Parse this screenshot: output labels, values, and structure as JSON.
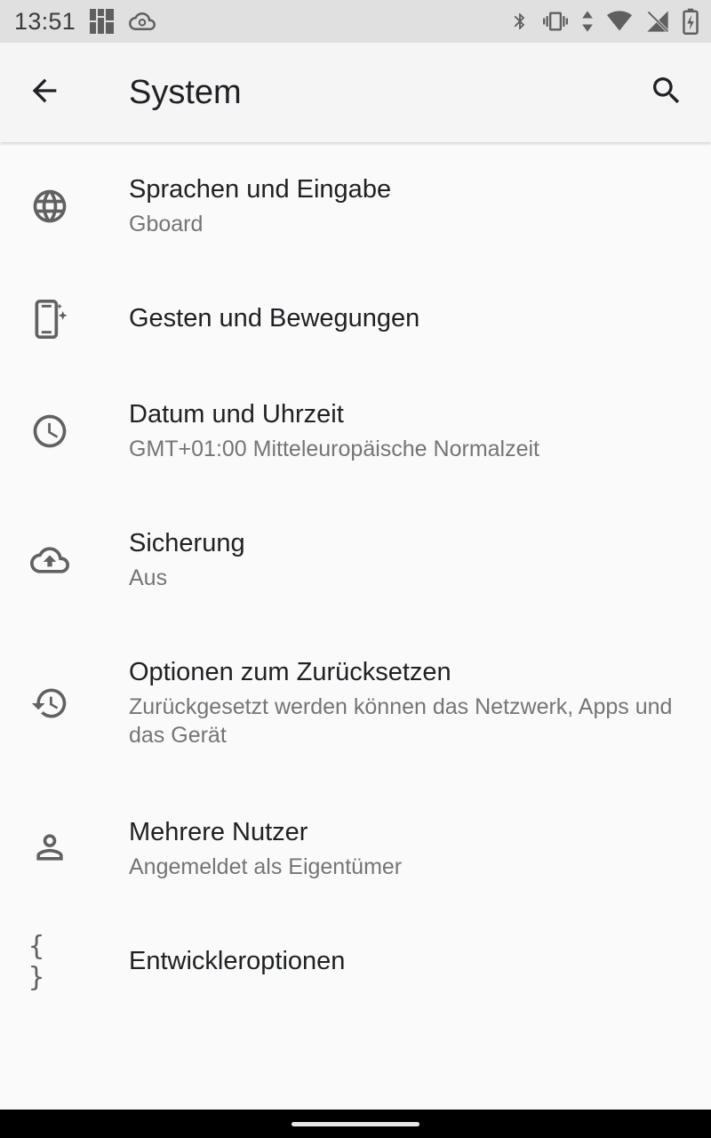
{
  "status_bar": {
    "time": "13:51",
    "left_icons": [
      "grid-app-icon",
      "cloud-sync-icon"
    ],
    "right_icons": [
      "bluetooth-icon",
      "vibrate-icon",
      "data-arrows-icon",
      "wifi-icon",
      "no-sim-icon",
      "battery-charging-icon"
    ]
  },
  "app_bar": {
    "title": "System",
    "back_icon": "arrow-back-icon",
    "search_icon": "search-icon"
  },
  "settings": [
    {
      "title": "Sprachen und Eingabe",
      "summary": "Gboard",
      "icon": "globe-icon"
    },
    {
      "title": "Gesten und Bewegungen",
      "summary": "",
      "icon": "gesture-phone-icon"
    },
    {
      "title": "Datum und Uhrzeit",
      "summary": "GMT+01:00 Mitteleuropäische Normalzeit",
      "icon": "clock-icon"
    },
    {
      "title": "Sicherung",
      "summary": "Aus",
      "icon": "cloud-upload-icon"
    },
    {
      "title": "Optionen zum Zurücksetzen",
      "summary": "Zurückgesetzt werden können das Netzwerk, Apps und das Gerät",
      "icon": "history-icon"
    },
    {
      "title": "Mehrere Nutzer",
      "summary": "Angemeldet als Eigentümer",
      "icon": "person-icon"
    },
    {
      "title": "Entwickleroptionen",
      "summary": "",
      "icon": "braces-icon"
    }
  ],
  "colors": {
    "status_bar_bg": "#e0e0e0",
    "app_bar_bg": "#f5f5f5",
    "background": "#fafafa",
    "title_text": "#202124",
    "summary_text": "#757575",
    "icon": "#616161"
  }
}
